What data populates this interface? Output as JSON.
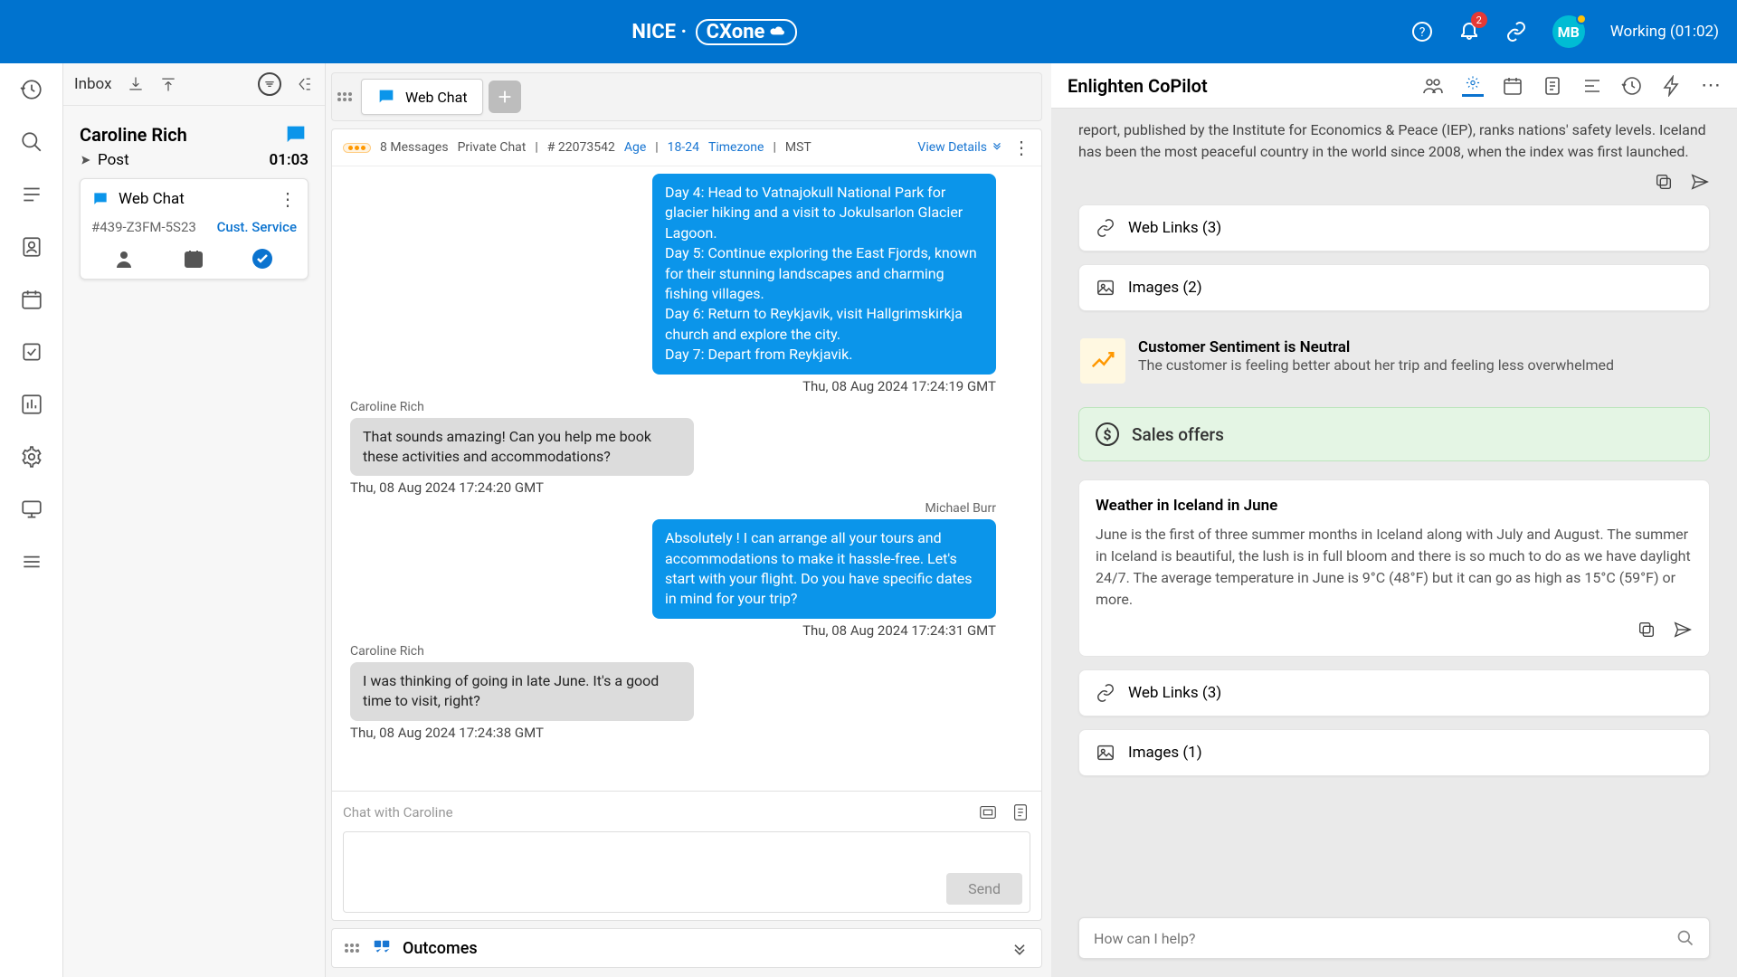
{
  "header": {
    "logo_left": "NICE",
    "logo_right": "CXone",
    "bell_count": "2",
    "avatar_initials": "MB",
    "status": "Working (01:02)"
  },
  "inbox": {
    "title": "Inbox",
    "contact_name": "Caroline Rich",
    "post_label": "Post",
    "timer": "01:03",
    "channel_label": "Web Chat",
    "case_id": "#439-Z3FM-5S23",
    "service": "Cust. Service"
  },
  "tab": {
    "label": "Web Chat"
  },
  "chat_meta": {
    "msg_count": "8 Messages",
    "type": "Private Chat",
    "id_label": "# 22073542",
    "age_lbl": "Age",
    "age_val": "18-24",
    "tz_lbl": "Timezone",
    "tz_val": "MST",
    "view": "View Details"
  },
  "chat": {
    "agent_name": "Michael Burr",
    "cust_name": "Caroline Rich",
    "m1": "Day 4: Head to Vatnajokull National Park for glacier hiking and a visit to Jokulsarlon Glacier Lagoon.\nDay 5: Continue exploring the East Fjords, known for their stunning landscapes and charming fishing villages.\nDay 6: Return to Reykjavik, visit Hallgrimskirkja church and explore the city.\nDay 7: Depart from Reykjavik.",
    "t1": "Thu, 08 Aug 2024 17:24:19 GMT",
    "m2": "That sounds amazing! Can you help me book these activities and accommodations?",
    "t2": "Thu, 08 Aug 2024 17:24:20 GMT",
    "m3": "Absolutely ! I can arrange all your tours and accommodations to make it hassle-free. Let's start with your flight. Do you have specific dates in mind for your trip?",
    "t3": "Thu, 08 Aug 2024 17:24:31 GMT",
    "m4": "I was thinking of going in late June. It's a good time to visit, right?",
    "t4": "Thu, 08 Aug 2024 17:24:38 GMT",
    "input_placeholder": "Chat with Caroline",
    "send": "Send"
  },
  "outcomes": {
    "label": "Outcomes"
  },
  "copilot": {
    "title": "Enlighten CoPilot",
    "kb_text": "report, published by the Institute for Economics & Peace (IEP), ranks nations' safety levels. Iceland has been the most peaceful country in the world since 2008, when the index was first launched.",
    "links1": "Web Links (3)",
    "images1": "Images (2)",
    "sent_title": "Customer Sentiment is Neutral",
    "sent_desc": "The customer is feeling better about her trip and feeling less overwhelmed",
    "sales": "Sales offers",
    "weather_title": "Weather in Iceland in June",
    "weather_body": "June is the first of three summer months in Iceland along with July and August. The summer in Iceland is beautiful, the lush is in full bloom and there is so much to do as we have daylight 24/7. The average temperature in June is 9°C (48°F) but it can go as high as 15°C (59°F) or more.",
    "links2": "Web Links (3)",
    "images2": "Images (1)",
    "input_ph": "How can I help?"
  }
}
